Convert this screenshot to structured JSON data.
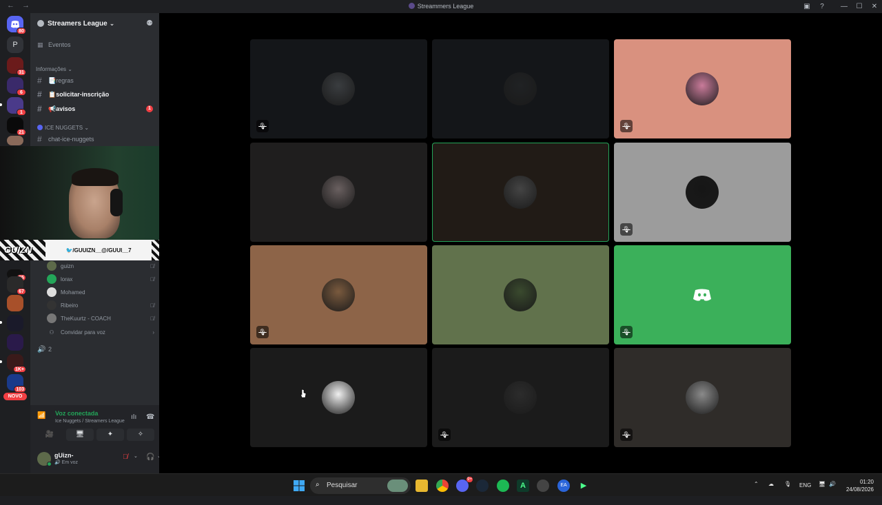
{
  "window": {
    "title": "Streammers League",
    "nav": "← →",
    "controls": [
      "▣",
      "?",
      "—",
      "☐",
      "✕"
    ]
  },
  "guild_rail": {
    "home_badge": "80",
    "letter_server": "P",
    "badges": [
      "31",
      "6",
      "1",
      "21",
      "55",
      "67",
      "1K+",
      "103"
    ],
    "new_label": "NOVO"
  },
  "server": {
    "name": "Streamers League",
    "chevron": "⌄",
    "events_label": "Eventos",
    "category_info": "Informações ⌄",
    "channels": [
      {
        "name": "📑regras",
        "bold": false
      },
      {
        "name": "📋solicitar-inscrição",
        "bold": true
      },
      {
        "name": "📢avisos",
        "bold": true,
        "unread": "1"
      }
    ],
    "category_ice": "ICE NUGGETS ⌄",
    "ice_channel": "chat-ice-nuggets",
    "voice_users": [
      {
        "name": "guizn",
        "muted": true
      },
      {
        "name": "lorax",
        "muted": true
      },
      {
        "name": "Mohamed",
        "muted": false
      },
      {
        "name": "Ribeiro",
        "muted": true
      },
      {
        "name": "TheKuurtz - COACH",
        "muted": true
      }
    ],
    "invite_label": "Convidar para voz",
    "invite_arrow": "›",
    "voice_count_label": "2"
  },
  "stream_overlay": {
    "logo_text": "GUIZN",
    "social_text": "🐦/GUUIZN__@/GUUI__7"
  },
  "voice_panel": {
    "status": "Voz conectada",
    "channel_path": "Ice Nuggets / Streamers League",
    "buttons": [
      "🎥",
      "🖥",
      "✦",
      "✧"
    ],
    "user_name": "gUizn-",
    "user_status": "Em voz"
  },
  "grid_tiles": [
    {
      "bg": "#141619",
      "muted": true,
      "av": "#3a3d40"
    },
    {
      "bg": "#141619",
      "muted": false,
      "av": "#202224"
    },
    {
      "bg": "#d9917f",
      "muted": true,
      "av": "#c97b9a"
    },
    {
      "bg": "#1f1e1e",
      "muted": false,
      "av": "#6a6060"
    },
    {
      "bg": "#211b16",
      "muted": false,
      "av": "#444444",
      "speaking": true
    },
    {
      "bg": "#9c9c9c",
      "muted": true,
      "av": "#161616"
    },
    {
      "bg": "#8d6448",
      "muted": true,
      "av": "#7a5a3e"
    },
    {
      "bg": "#61724c",
      "muted": false,
      "av": "#3a4a2e"
    },
    {
      "bg": "#3bb05a",
      "muted": true,
      "discord": true
    },
    {
      "bg": "#1b1b1b",
      "muted": false,
      "av": "#f0f0f0"
    },
    {
      "bg": "#1b1b1b",
      "muted": true,
      "av": "#2c2c2c"
    },
    {
      "bg": "#2f2c29",
      "muted": true,
      "av": "#8a8a8a"
    }
  ],
  "taskbar": {
    "search_placeholder": "Pesquisar",
    "lang": "ENG",
    "time": "01:20",
    "date": "24/08/2026",
    "discord_badge": "9+"
  }
}
